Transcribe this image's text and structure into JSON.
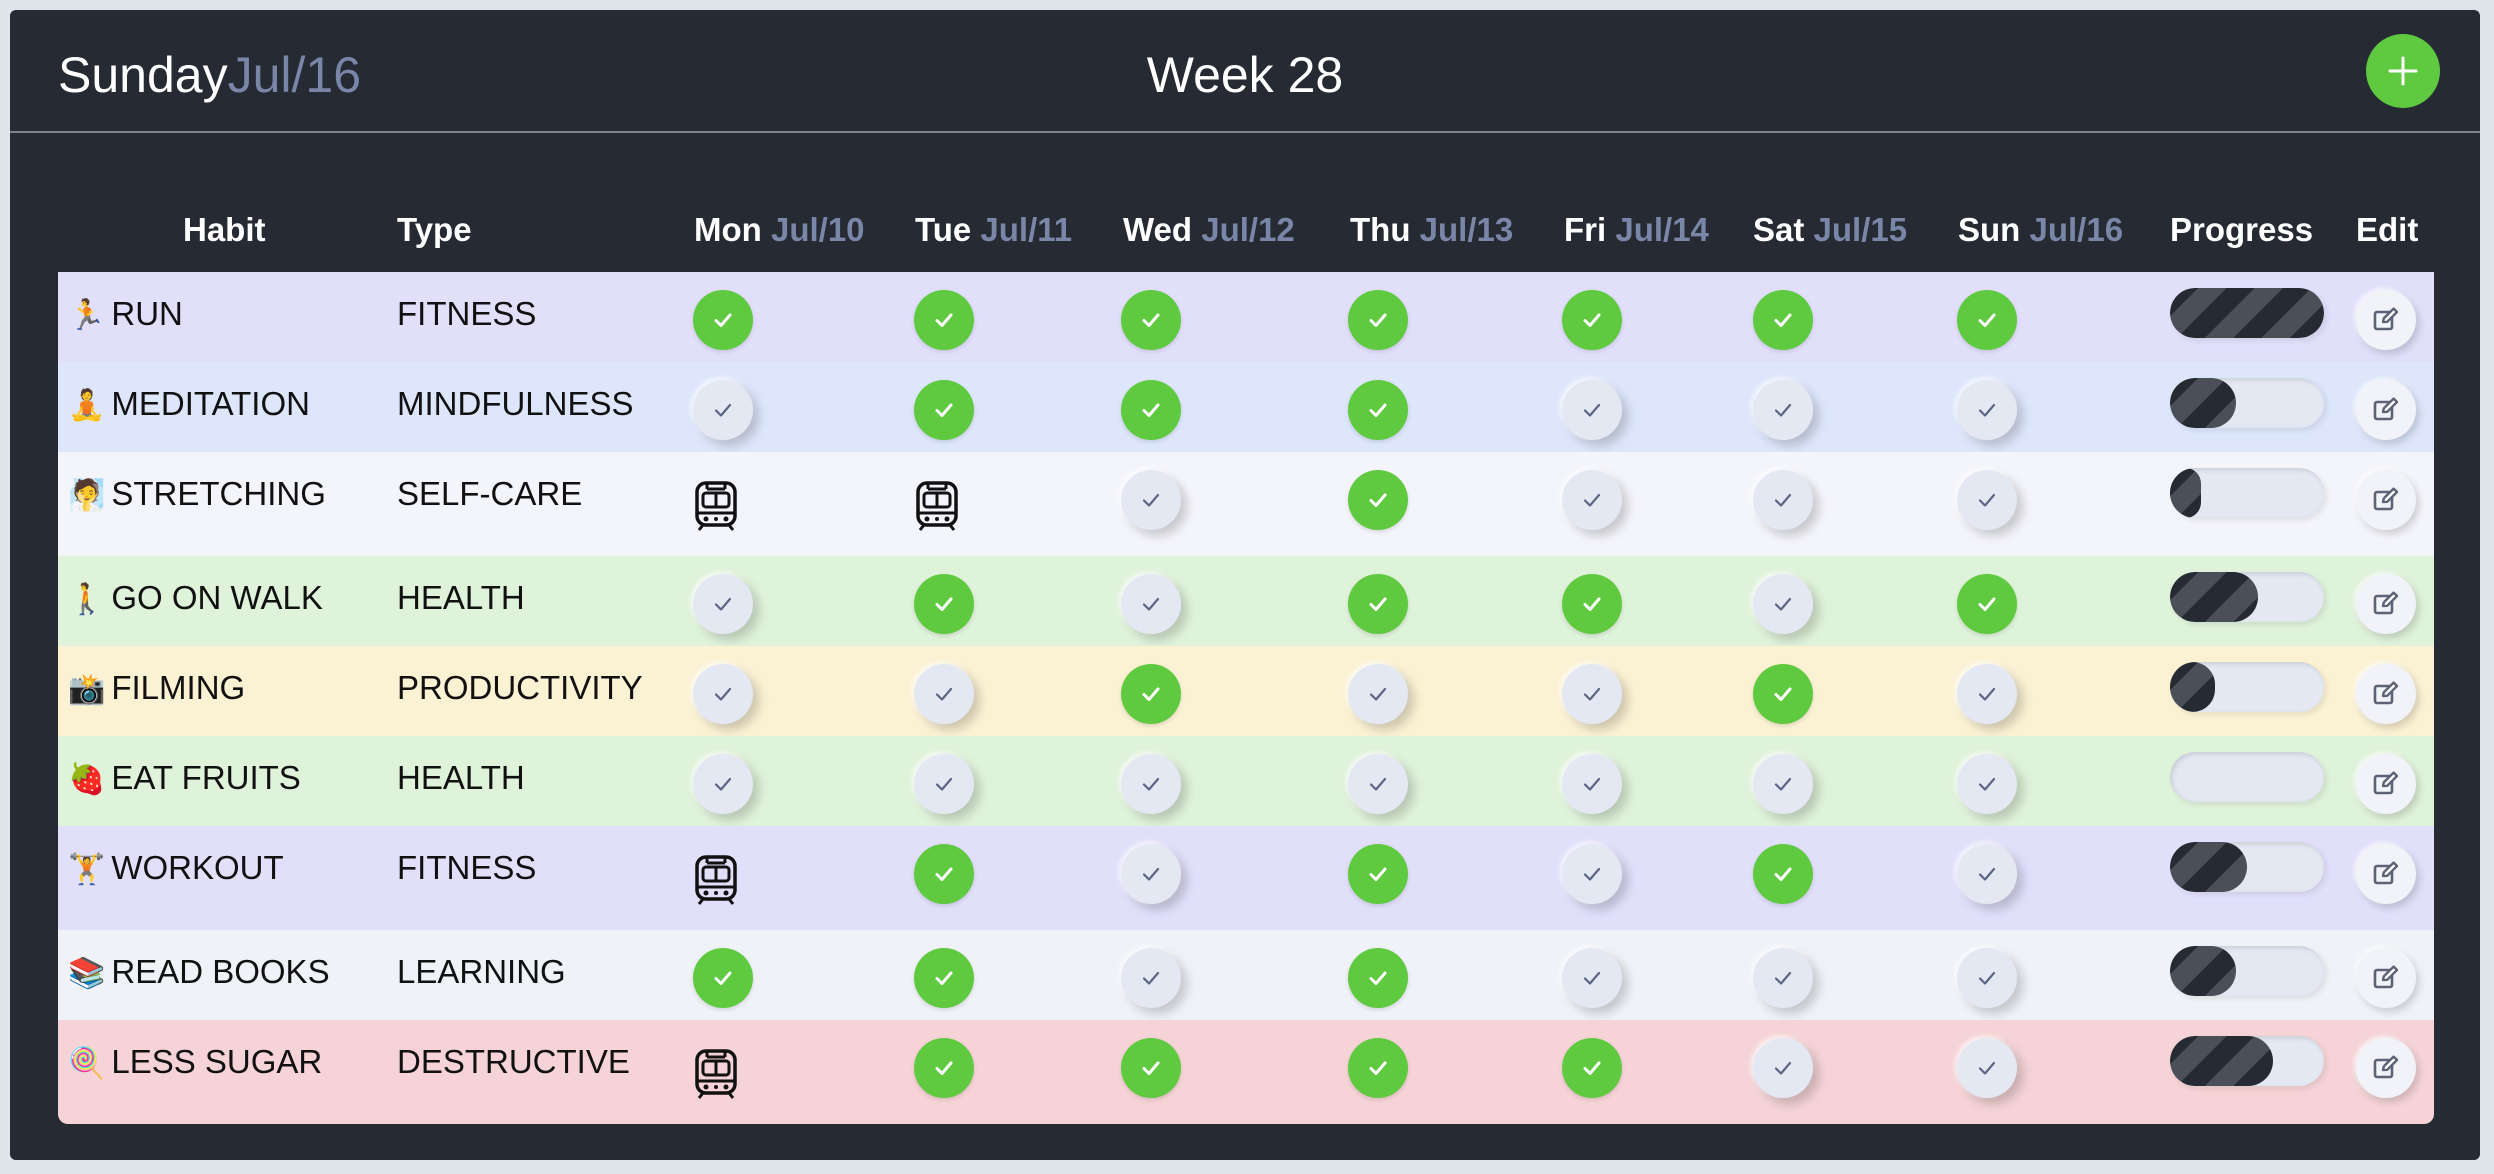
{
  "header": {
    "day": "Sunday",
    "date": "Jul/16",
    "week": "Week 28",
    "add_icon": "plus-icon",
    "accent": "#5fc940"
  },
  "table": {
    "columns": {
      "habit": "Habit",
      "type": "Type",
      "days": [
        {
          "day": "Mon",
          "date": "Jul/10"
        },
        {
          "day": "Tue",
          "date": "Jul/11"
        },
        {
          "day": "Wed",
          "date": "Jul/12"
        },
        {
          "day": "Thu",
          "date": "Jul/13"
        },
        {
          "day": "Fri",
          "date": "Jul/14"
        },
        {
          "day": "Sat",
          "date": "Jul/15"
        },
        {
          "day": "Sun",
          "date": "Jul/16"
        }
      ],
      "progress": "Progress",
      "edit": "Edit"
    },
    "legend": {
      "done": "check-icon green",
      "todo": "check-icon grey",
      "skip": "train-icon"
    },
    "rows": [
      {
        "emoji": "🏃",
        "name": "RUN",
        "type": "FITNESS",
        "color": "#e1dffa",
        "status": [
          "done",
          "done",
          "done",
          "done",
          "done",
          "done",
          "done"
        ],
        "progress": 1.0
      },
      {
        "emoji": "🧘",
        "name": "MEDITATION",
        "type": "MINDFULNESS",
        "color": "#dde6fb",
        "status": [
          "todo",
          "done",
          "done",
          "done",
          "todo",
          "todo",
          "todo"
        ],
        "progress": 0.43
      },
      {
        "emoji": "🧖",
        "name": "STRETCHING",
        "type": "SELF-CARE",
        "color": "#f4f5fa",
        "status": [
          "skip",
          "skip",
          "todo",
          "done",
          "todo",
          "todo",
          "todo"
        ],
        "progress": 0.2
      },
      {
        "emoji": "🚶",
        "name": "GO ON WALK",
        "type": "HEALTH",
        "color": "#dff2da",
        "status": [
          "todo",
          "done",
          "todo",
          "done",
          "done",
          "todo",
          "done"
        ],
        "progress": 0.57
      },
      {
        "emoji": "📸",
        "name": "FILMING",
        "type": "PRODUCTIVITY",
        "color": "#fbf1d3",
        "status": [
          "todo",
          "todo",
          "done",
          "todo",
          "todo",
          "done",
          "todo"
        ],
        "progress": 0.29
      },
      {
        "emoji": "🍓",
        "name": "EAT FRUITS",
        "type": "HEALTH",
        "color": "#dff2da",
        "status": [
          "todo",
          "todo",
          "todo",
          "todo",
          "todo",
          "todo",
          "todo"
        ],
        "progress": 0
      },
      {
        "emoji": "🏋",
        "name": "WORKOUT",
        "type": "FITNESS",
        "color": "#e1dffa",
        "status": [
          "skip",
          "done",
          "todo",
          "done",
          "todo",
          "done",
          "todo"
        ],
        "progress": 0.5
      },
      {
        "emoji": "📚",
        "name": "READ BOOKS",
        "type": "LEARNING",
        "color": "#eff2f7",
        "status": [
          "done",
          "done",
          "todo",
          "done",
          "todo",
          "todo",
          "todo"
        ],
        "progress": 0.43
      },
      {
        "emoji": "🍭",
        "name": "LESS SUGAR",
        "type": "DESTRUCTIVE",
        "color": "#f5d3d6",
        "status": [
          "skip",
          "done",
          "done",
          "done",
          "done",
          "todo",
          "todo"
        ],
        "progress": 0.67
      }
    ]
  }
}
